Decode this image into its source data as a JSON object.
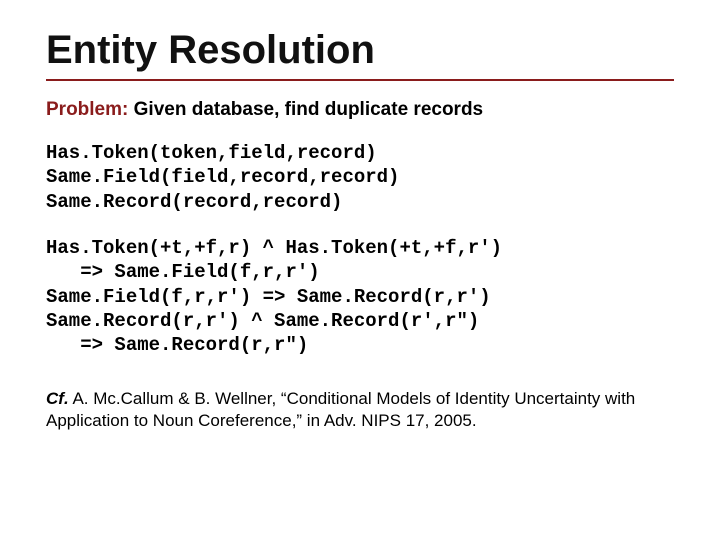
{
  "title": "Entity Resolution",
  "problem": {
    "label": "Problem:",
    "text": " Given database, find duplicate records"
  },
  "predicates": "Has.Token(token,field,record)\nSame.Field(field,record,record)\nSame.Record(record,record)",
  "rules": "Has.Token(+t,+f,r) ^ Has.Token(+t,+f,r')\n   => Same.Field(f,r,r')\nSame.Field(f,r,r') => Same.Record(r,r')\nSame.Record(r,r') ^ Same.Record(r',r\")\n   => Same.Record(r,r\")",
  "citation": {
    "cf": "Cf.",
    "text": "  A. Mc.Callum & B. Wellner, “Conditional Models of Identity Uncertainty with Application to Noun Coreference,” in Adv. NIPS 17, 2005."
  }
}
